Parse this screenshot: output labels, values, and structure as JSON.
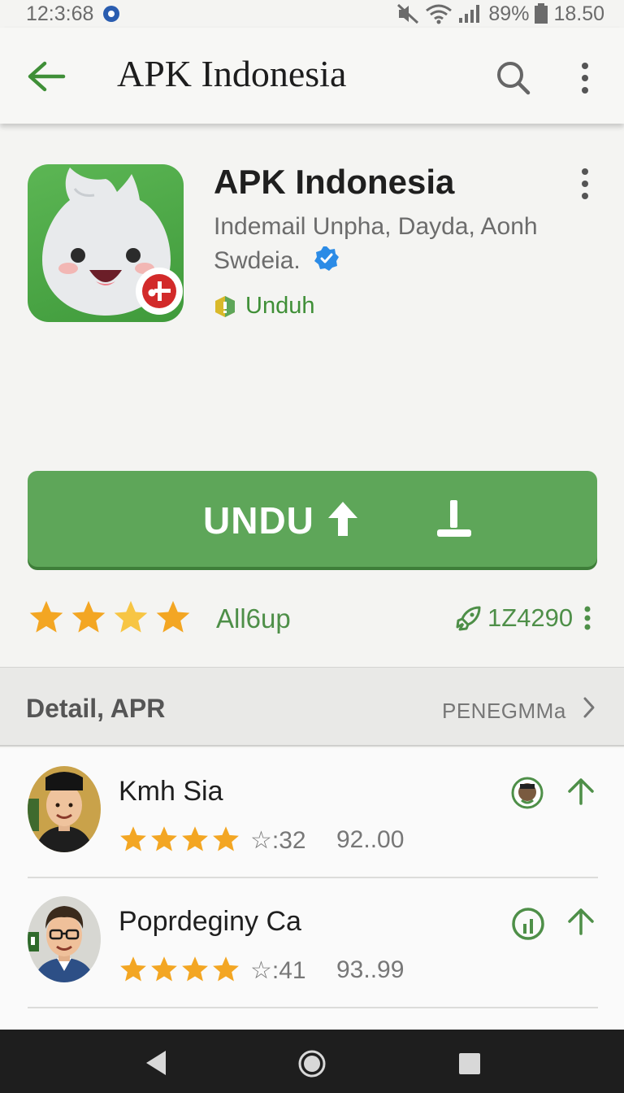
{
  "status_bar": {
    "time": "12:3:68",
    "battery": "89%",
    "clock_right": "18.50"
  },
  "app_bar": {
    "title": "APK Indonesia"
  },
  "app": {
    "name": "APK Indonesia",
    "developer_line1": "Indemail Unpha, Dayda, Aonh",
    "developer_line2": "Swdeia.",
    "tag": "Unduh"
  },
  "primary_button": {
    "label": "UNDU"
  },
  "rating": {
    "text": "All6up",
    "downloads": "1Z4290",
    "stars": 4
  },
  "detail": {
    "title": "Detail, APR",
    "link": "PENEGMMa"
  },
  "list": [
    {
      "name": "Kmh Sia",
      "stars": 4,
      "count": "☆:32",
      "price": "92..00"
    },
    {
      "name": "Poprdeginy Ca",
      "stars": 4,
      "count": "☆:41",
      "price": "93..99"
    }
  ],
  "colors": {
    "accent": "#5ea659",
    "accent_text": "#3f8f37",
    "star": "#f3a623",
    "nav": "#1e1e1e"
  },
  "icons": [
    "back-arrow-icon",
    "search-icon",
    "more-icon",
    "verified-icon",
    "shield-icon",
    "upload-arrow-icon",
    "download-icon",
    "star-icon",
    "rocket-icon",
    "chevron-right-icon"
  ]
}
